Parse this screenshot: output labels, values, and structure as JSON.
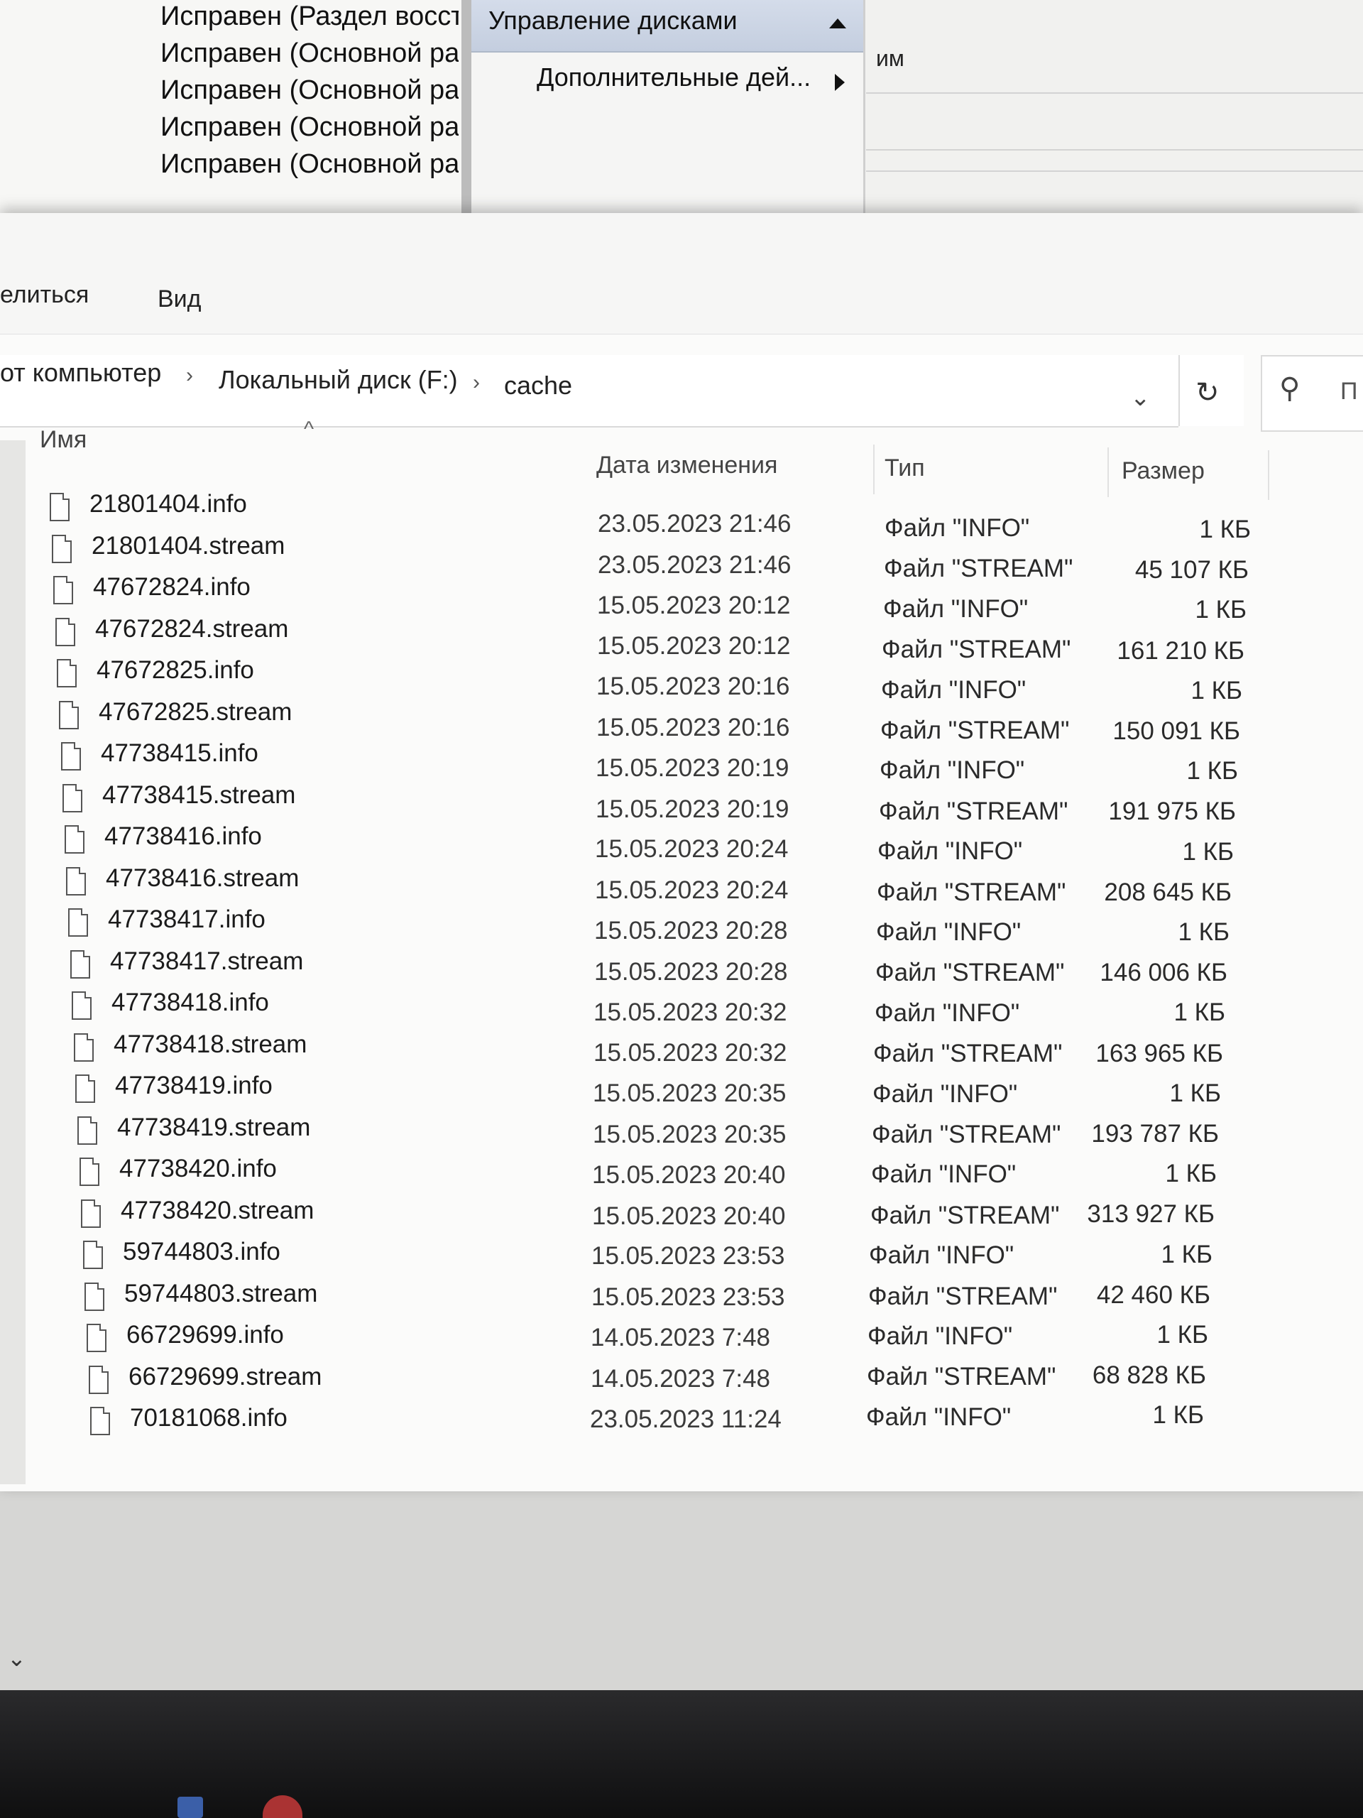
{
  "disk_management": {
    "status_lines": [
      "Исправен (Раздел восста",
      "Исправен (Основной раз",
      "Исправен (Основной раз",
      "Исправен (Основной раз",
      "Исправен (Основной раз"
    ],
    "actions_header": "Управление дисками",
    "actions_more": "Дополнительные дей...",
    "right_panel_text": "им"
  },
  "explorer": {
    "ribbon_tabs": [
      "елиться",
      "Вид"
    ],
    "breadcrumb": [
      "от компьютер",
      "Локальный диск (F:)",
      "cache"
    ],
    "search_placeholder": "П",
    "columns": {
      "name": "Имя",
      "date": "Дата изменения",
      "type": "Тип",
      "size": "Размер"
    },
    "files": [
      {
        "name": "21801404.info",
        "date": "23.05.2023 21:46",
        "type": "Файл \"INFO\"",
        "size": "1 КБ"
      },
      {
        "name": "21801404.stream",
        "date": "23.05.2023 21:46",
        "type": "Файл \"STREAM\"",
        "size": "45 107 КБ"
      },
      {
        "name": "47672824.info",
        "date": "15.05.2023 20:12",
        "type": "Файл \"INFO\"",
        "size": "1 КБ"
      },
      {
        "name": "47672824.stream",
        "date": "15.05.2023 20:12",
        "type": "Файл \"STREAM\"",
        "size": "161 210 КБ"
      },
      {
        "name": "47672825.info",
        "date": "15.05.2023 20:16",
        "type": "Файл \"INFO\"",
        "size": "1 КБ"
      },
      {
        "name": "47672825.stream",
        "date": "15.05.2023 20:16",
        "type": "Файл \"STREAM\"",
        "size": "150 091 КБ"
      },
      {
        "name": "47738415.info",
        "date": "15.05.2023 20:19",
        "type": "Файл \"INFO\"",
        "size": "1 КБ"
      },
      {
        "name": "47738415.stream",
        "date": "15.05.2023 20:19",
        "type": "Файл \"STREAM\"",
        "size": "191 975 КБ"
      },
      {
        "name": "47738416.info",
        "date": "15.05.2023 20:24",
        "type": "Файл \"INFO\"",
        "size": "1 КБ"
      },
      {
        "name": "47738416.stream",
        "date": "15.05.2023 20:24",
        "type": "Файл \"STREAM\"",
        "size": "208 645 КБ"
      },
      {
        "name": "47738417.info",
        "date": "15.05.2023 20:28",
        "type": "Файл \"INFO\"",
        "size": "1 КБ"
      },
      {
        "name": "47738417.stream",
        "date": "15.05.2023 20:28",
        "type": "Файл \"STREAM\"",
        "size": "146 006 КБ"
      },
      {
        "name": "47738418.info",
        "date": "15.05.2023 20:32",
        "type": "Файл \"INFO\"",
        "size": "1 КБ"
      },
      {
        "name": "47738418.stream",
        "date": "15.05.2023 20:32",
        "type": "Файл \"STREAM\"",
        "size": "163 965 КБ"
      },
      {
        "name": "47738419.info",
        "date": "15.05.2023 20:35",
        "type": "Файл \"INFO\"",
        "size": "1 КБ"
      },
      {
        "name": "47738419.stream",
        "date": "15.05.2023 20:35",
        "type": "Файл \"STREAM\"",
        "size": "193 787 КБ"
      },
      {
        "name": "47738420.info",
        "date": "15.05.2023 20:40",
        "type": "Файл \"INFO\"",
        "size": "1 КБ"
      },
      {
        "name": "47738420.stream",
        "date": "15.05.2023 20:40",
        "type": "Файл \"STREAM\"",
        "size": "313 927 КБ"
      },
      {
        "name": "59744803.info",
        "date": "15.05.2023 23:53",
        "type": "Файл \"INFO\"",
        "size": "1 КБ"
      },
      {
        "name": "59744803.stream",
        "date": "15.05.2023 23:53",
        "type": "Файл \"STREAM\"",
        "size": "42 460 КБ"
      },
      {
        "name": "66729699.info",
        "date": "14.05.2023 7:48",
        "type": "Файл \"INFO\"",
        "size": "1 КБ"
      },
      {
        "name": "66729699.stream",
        "date": "14.05.2023 7:48",
        "type": "Файл \"STREAM\"",
        "size": "68 828 КБ"
      },
      {
        "name": "70181068.info",
        "date": "23.05.2023 11:24",
        "type": "Файл \"INFO\"",
        "size": "1 КБ"
      }
    ]
  },
  "icons": {
    "file": "file-icon",
    "sort": "sort-ascending-icon",
    "refresh": "refresh-icon",
    "search": "search-icon",
    "dropdown": "chevron-down-icon"
  }
}
